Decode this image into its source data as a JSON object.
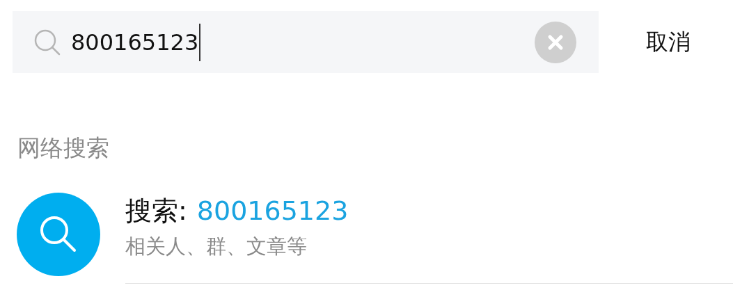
{
  "search": {
    "value": "800165123",
    "focused": true
  },
  "cancel": "取消",
  "section_title": "网络搜索",
  "results": [
    {
      "label": "搜索:",
      "query": "800165123",
      "subtitle": "相关人、群、文章等"
    }
  ]
}
